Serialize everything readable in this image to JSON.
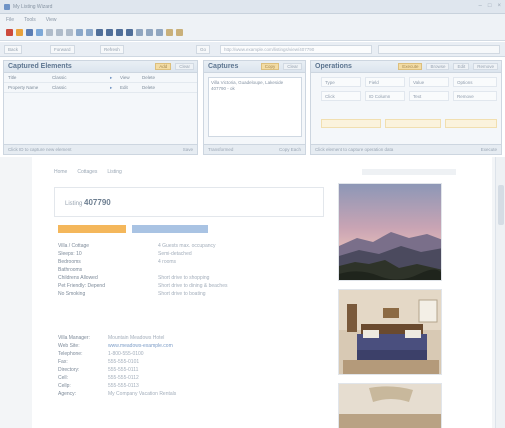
{
  "window": {
    "title": "My Listing Wizard"
  },
  "menu": [
    "File",
    "Tools",
    "View"
  ],
  "addressbar": {
    "back_label": "Back",
    "forward_label": "Forward",
    "refresh_label": "Refresh",
    "go_label": "Go",
    "url": "http://www.example.com/listings/view/407790"
  },
  "captured_elements": {
    "title": "Captured Elements",
    "buttons": [
      "Add",
      "Clear"
    ],
    "rows": [
      {
        "name": "Title",
        "type": "Classic",
        "a": "View",
        "b": "Delete"
      },
      {
        "name": "Property Name",
        "type": "Classic",
        "a": "Edit",
        "b": "Delete"
      }
    ],
    "footer": [
      "Click ID to capture new element",
      "Save"
    ]
  },
  "captures": {
    "title": "Captures",
    "buttons": [
      "Copy",
      "Clear"
    ],
    "text": "Villa Victoria, Guadeloupe, Lakeside 407790 - ok",
    "footer": [
      "Transformed",
      "Copy Each"
    ]
  },
  "operations": {
    "title": "Operations",
    "buttons": [
      "Execute",
      "Browse",
      "Edit",
      "Remove"
    ],
    "grid": [
      [
        "Type",
        "Field",
        "Value",
        "Options"
      ],
      [
        "Click",
        "ID Column",
        "Text",
        "Remove"
      ]
    ],
    "footer": [
      "Click element to capture operation data",
      "Execute"
    ]
  },
  "page": {
    "crumbs": [
      "Home",
      "Cottages",
      "Listing"
    ],
    "listing_label": "Listing",
    "listing_id": "407790",
    "details": [
      {
        "k": "Villa / Cottage",
        "v": "4 Guests max. occupancy"
      },
      {
        "k": "Sleeps: 10",
        "v": "Semi-detached"
      },
      {
        "k": "Bedrooms",
        "v": "4 rooms"
      },
      {
        "k": "Bathrooms",
        "v": ""
      },
      {
        "k": "Childrens Allowed",
        "v": "Short drive to shopping"
      },
      {
        "k": "Pet Friendly: Depend",
        "v": "Short drive to dining & beaches"
      },
      {
        "k": "No Smoking",
        "v": "Short drive to boating"
      }
    ],
    "contact": [
      {
        "k": "Villa Manager:",
        "v": "Mountain Meadows Hotel"
      },
      {
        "k": "Web Site:",
        "v": "www.meadows-example.com"
      },
      {
        "k": "Telephone:",
        "v": "1-800-555-0100"
      },
      {
        "k": "Fax:",
        "v": "555-555-0101"
      },
      {
        "k": "Directory:",
        "v": "555-555-0111"
      },
      {
        "k": "Cell:",
        "v": "555-555-0112"
      },
      {
        "k": "Cellp:",
        "v": "555-555-0113"
      },
      {
        "k": "Agency:",
        "v": "My Company Vacation Rentals"
      }
    ]
  },
  "colors": {
    "accent_orange": "#f4b75b",
    "accent_blue": "#a9c3e3",
    "panel_bg": "#f4f7fa"
  }
}
